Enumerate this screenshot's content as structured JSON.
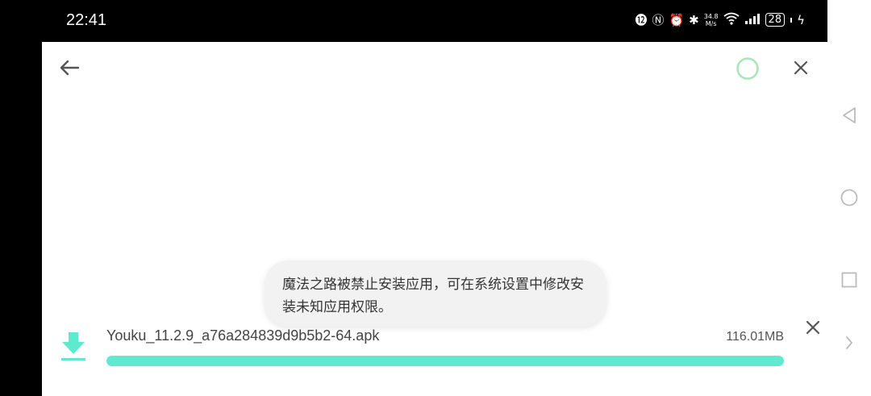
{
  "status_bar": {
    "time": "22:41",
    "net_speed_value": "34.8",
    "net_speed_unit": "M/s",
    "battery": "28",
    "icons": [
      "data-usage-icon",
      "nfc-icon",
      "alarm-icon",
      "bluetooth-icon",
      "wifi-icon",
      "signal-icon",
      "battery-icon",
      "charging-icon"
    ]
  },
  "header": {
    "back_icon": "arrow-left-icon",
    "loading_icon": "progress-ring-icon",
    "close_icon": "close-icon"
  },
  "toast": {
    "message": "魔法之路被禁止安装应用，可在系统设置中修改安装未知应用权限。"
  },
  "download": {
    "file_name": "Youku_11.2.9_a76a284839d9b5b2-64.apk",
    "file_size": "116.01MB",
    "progress": 1.0,
    "icon": "download-icon",
    "cancel_icon": "close-icon"
  },
  "navigation": {
    "back_icon": "triangle-back-icon",
    "home_icon": "circle-home-icon",
    "recents_icon": "square-recents-icon",
    "expand_icon": "chevron-right-icon"
  },
  "colors": {
    "accent": "#5EEACE",
    "ring": "#A8E6B8",
    "icon_gray": "#555555",
    "nav_gray": "#BBBBBB"
  }
}
